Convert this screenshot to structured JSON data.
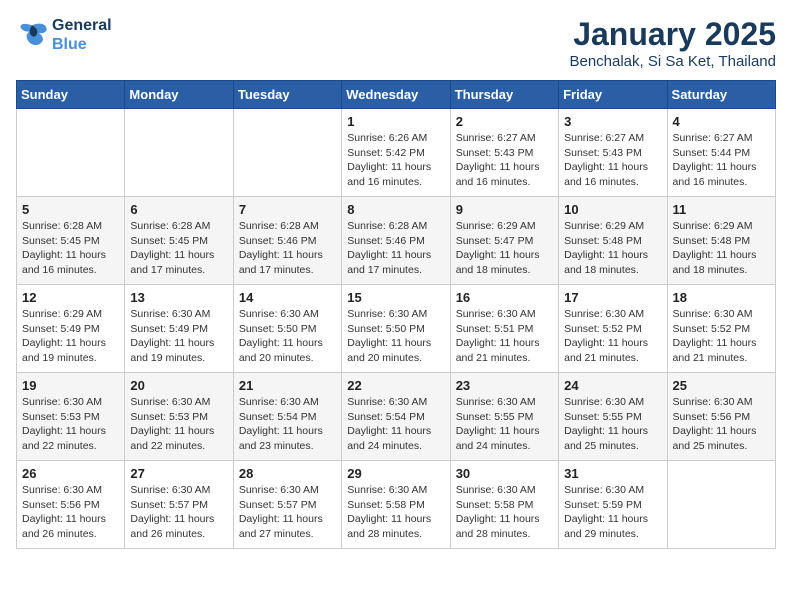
{
  "header": {
    "logo_line1": "General",
    "logo_line2": "Blue",
    "main_title": "January 2025",
    "subtitle": "Benchalak, Si Sa Ket, Thailand"
  },
  "weekdays": [
    "Sunday",
    "Monday",
    "Tuesday",
    "Wednesday",
    "Thursday",
    "Friday",
    "Saturday"
  ],
  "weeks": [
    [
      {
        "day": "",
        "info": ""
      },
      {
        "day": "",
        "info": ""
      },
      {
        "day": "",
        "info": ""
      },
      {
        "day": "1",
        "info": "Sunrise: 6:26 AM\nSunset: 5:42 PM\nDaylight: 11 hours\nand 16 minutes."
      },
      {
        "day": "2",
        "info": "Sunrise: 6:27 AM\nSunset: 5:43 PM\nDaylight: 11 hours\nand 16 minutes."
      },
      {
        "day": "3",
        "info": "Sunrise: 6:27 AM\nSunset: 5:43 PM\nDaylight: 11 hours\nand 16 minutes."
      },
      {
        "day": "4",
        "info": "Sunrise: 6:27 AM\nSunset: 5:44 PM\nDaylight: 11 hours\nand 16 minutes."
      }
    ],
    [
      {
        "day": "5",
        "info": "Sunrise: 6:28 AM\nSunset: 5:45 PM\nDaylight: 11 hours\nand 16 minutes."
      },
      {
        "day": "6",
        "info": "Sunrise: 6:28 AM\nSunset: 5:45 PM\nDaylight: 11 hours\nand 17 minutes."
      },
      {
        "day": "7",
        "info": "Sunrise: 6:28 AM\nSunset: 5:46 PM\nDaylight: 11 hours\nand 17 minutes."
      },
      {
        "day": "8",
        "info": "Sunrise: 6:28 AM\nSunset: 5:46 PM\nDaylight: 11 hours\nand 17 minutes."
      },
      {
        "day": "9",
        "info": "Sunrise: 6:29 AM\nSunset: 5:47 PM\nDaylight: 11 hours\nand 18 minutes."
      },
      {
        "day": "10",
        "info": "Sunrise: 6:29 AM\nSunset: 5:48 PM\nDaylight: 11 hours\nand 18 minutes."
      },
      {
        "day": "11",
        "info": "Sunrise: 6:29 AM\nSunset: 5:48 PM\nDaylight: 11 hours\nand 18 minutes."
      }
    ],
    [
      {
        "day": "12",
        "info": "Sunrise: 6:29 AM\nSunset: 5:49 PM\nDaylight: 11 hours\nand 19 minutes."
      },
      {
        "day": "13",
        "info": "Sunrise: 6:30 AM\nSunset: 5:49 PM\nDaylight: 11 hours\nand 19 minutes."
      },
      {
        "day": "14",
        "info": "Sunrise: 6:30 AM\nSunset: 5:50 PM\nDaylight: 11 hours\nand 20 minutes."
      },
      {
        "day": "15",
        "info": "Sunrise: 6:30 AM\nSunset: 5:50 PM\nDaylight: 11 hours\nand 20 minutes."
      },
      {
        "day": "16",
        "info": "Sunrise: 6:30 AM\nSunset: 5:51 PM\nDaylight: 11 hours\nand 21 minutes."
      },
      {
        "day": "17",
        "info": "Sunrise: 6:30 AM\nSunset: 5:52 PM\nDaylight: 11 hours\nand 21 minutes."
      },
      {
        "day": "18",
        "info": "Sunrise: 6:30 AM\nSunset: 5:52 PM\nDaylight: 11 hours\nand 21 minutes."
      }
    ],
    [
      {
        "day": "19",
        "info": "Sunrise: 6:30 AM\nSunset: 5:53 PM\nDaylight: 11 hours\nand 22 minutes."
      },
      {
        "day": "20",
        "info": "Sunrise: 6:30 AM\nSunset: 5:53 PM\nDaylight: 11 hours\nand 22 minutes."
      },
      {
        "day": "21",
        "info": "Sunrise: 6:30 AM\nSunset: 5:54 PM\nDaylight: 11 hours\nand 23 minutes."
      },
      {
        "day": "22",
        "info": "Sunrise: 6:30 AM\nSunset: 5:54 PM\nDaylight: 11 hours\nand 24 minutes."
      },
      {
        "day": "23",
        "info": "Sunrise: 6:30 AM\nSunset: 5:55 PM\nDaylight: 11 hours\nand 24 minutes."
      },
      {
        "day": "24",
        "info": "Sunrise: 6:30 AM\nSunset: 5:55 PM\nDaylight: 11 hours\nand 25 minutes."
      },
      {
        "day": "25",
        "info": "Sunrise: 6:30 AM\nSunset: 5:56 PM\nDaylight: 11 hours\nand 25 minutes."
      }
    ],
    [
      {
        "day": "26",
        "info": "Sunrise: 6:30 AM\nSunset: 5:56 PM\nDaylight: 11 hours\nand 26 minutes."
      },
      {
        "day": "27",
        "info": "Sunrise: 6:30 AM\nSunset: 5:57 PM\nDaylight: 11 hours\nand 26 minutes."
      },
      {
        "day": "28",
        "info": "Sunrise: 6:30 AM\nSunset: 5:57 PM\nDaylight: 11 hours\nand 27 minutes."
      },
      {
        "day": "29",
        "info": "Sunrise: 6:30 AM\nSunset: 5:58 PM\nDaylight: 11 hours\nand 28 minutes."
      },
      {
        "day": "30",
        "info": "Sunrise: 6:30 AM\nSunset: 5:58 PM\nDaylight: 11 hours\nand 28 minutes."
      },
      {
        "day": "31",
        "info": "Sunrise: 6:30 AM\nSunset: 5:59 PM\nDaylight: 11 hours\nand 29 minutes."
      },
      {
        "day": "",
        "info": ""
      }
    ]
  ]
}
